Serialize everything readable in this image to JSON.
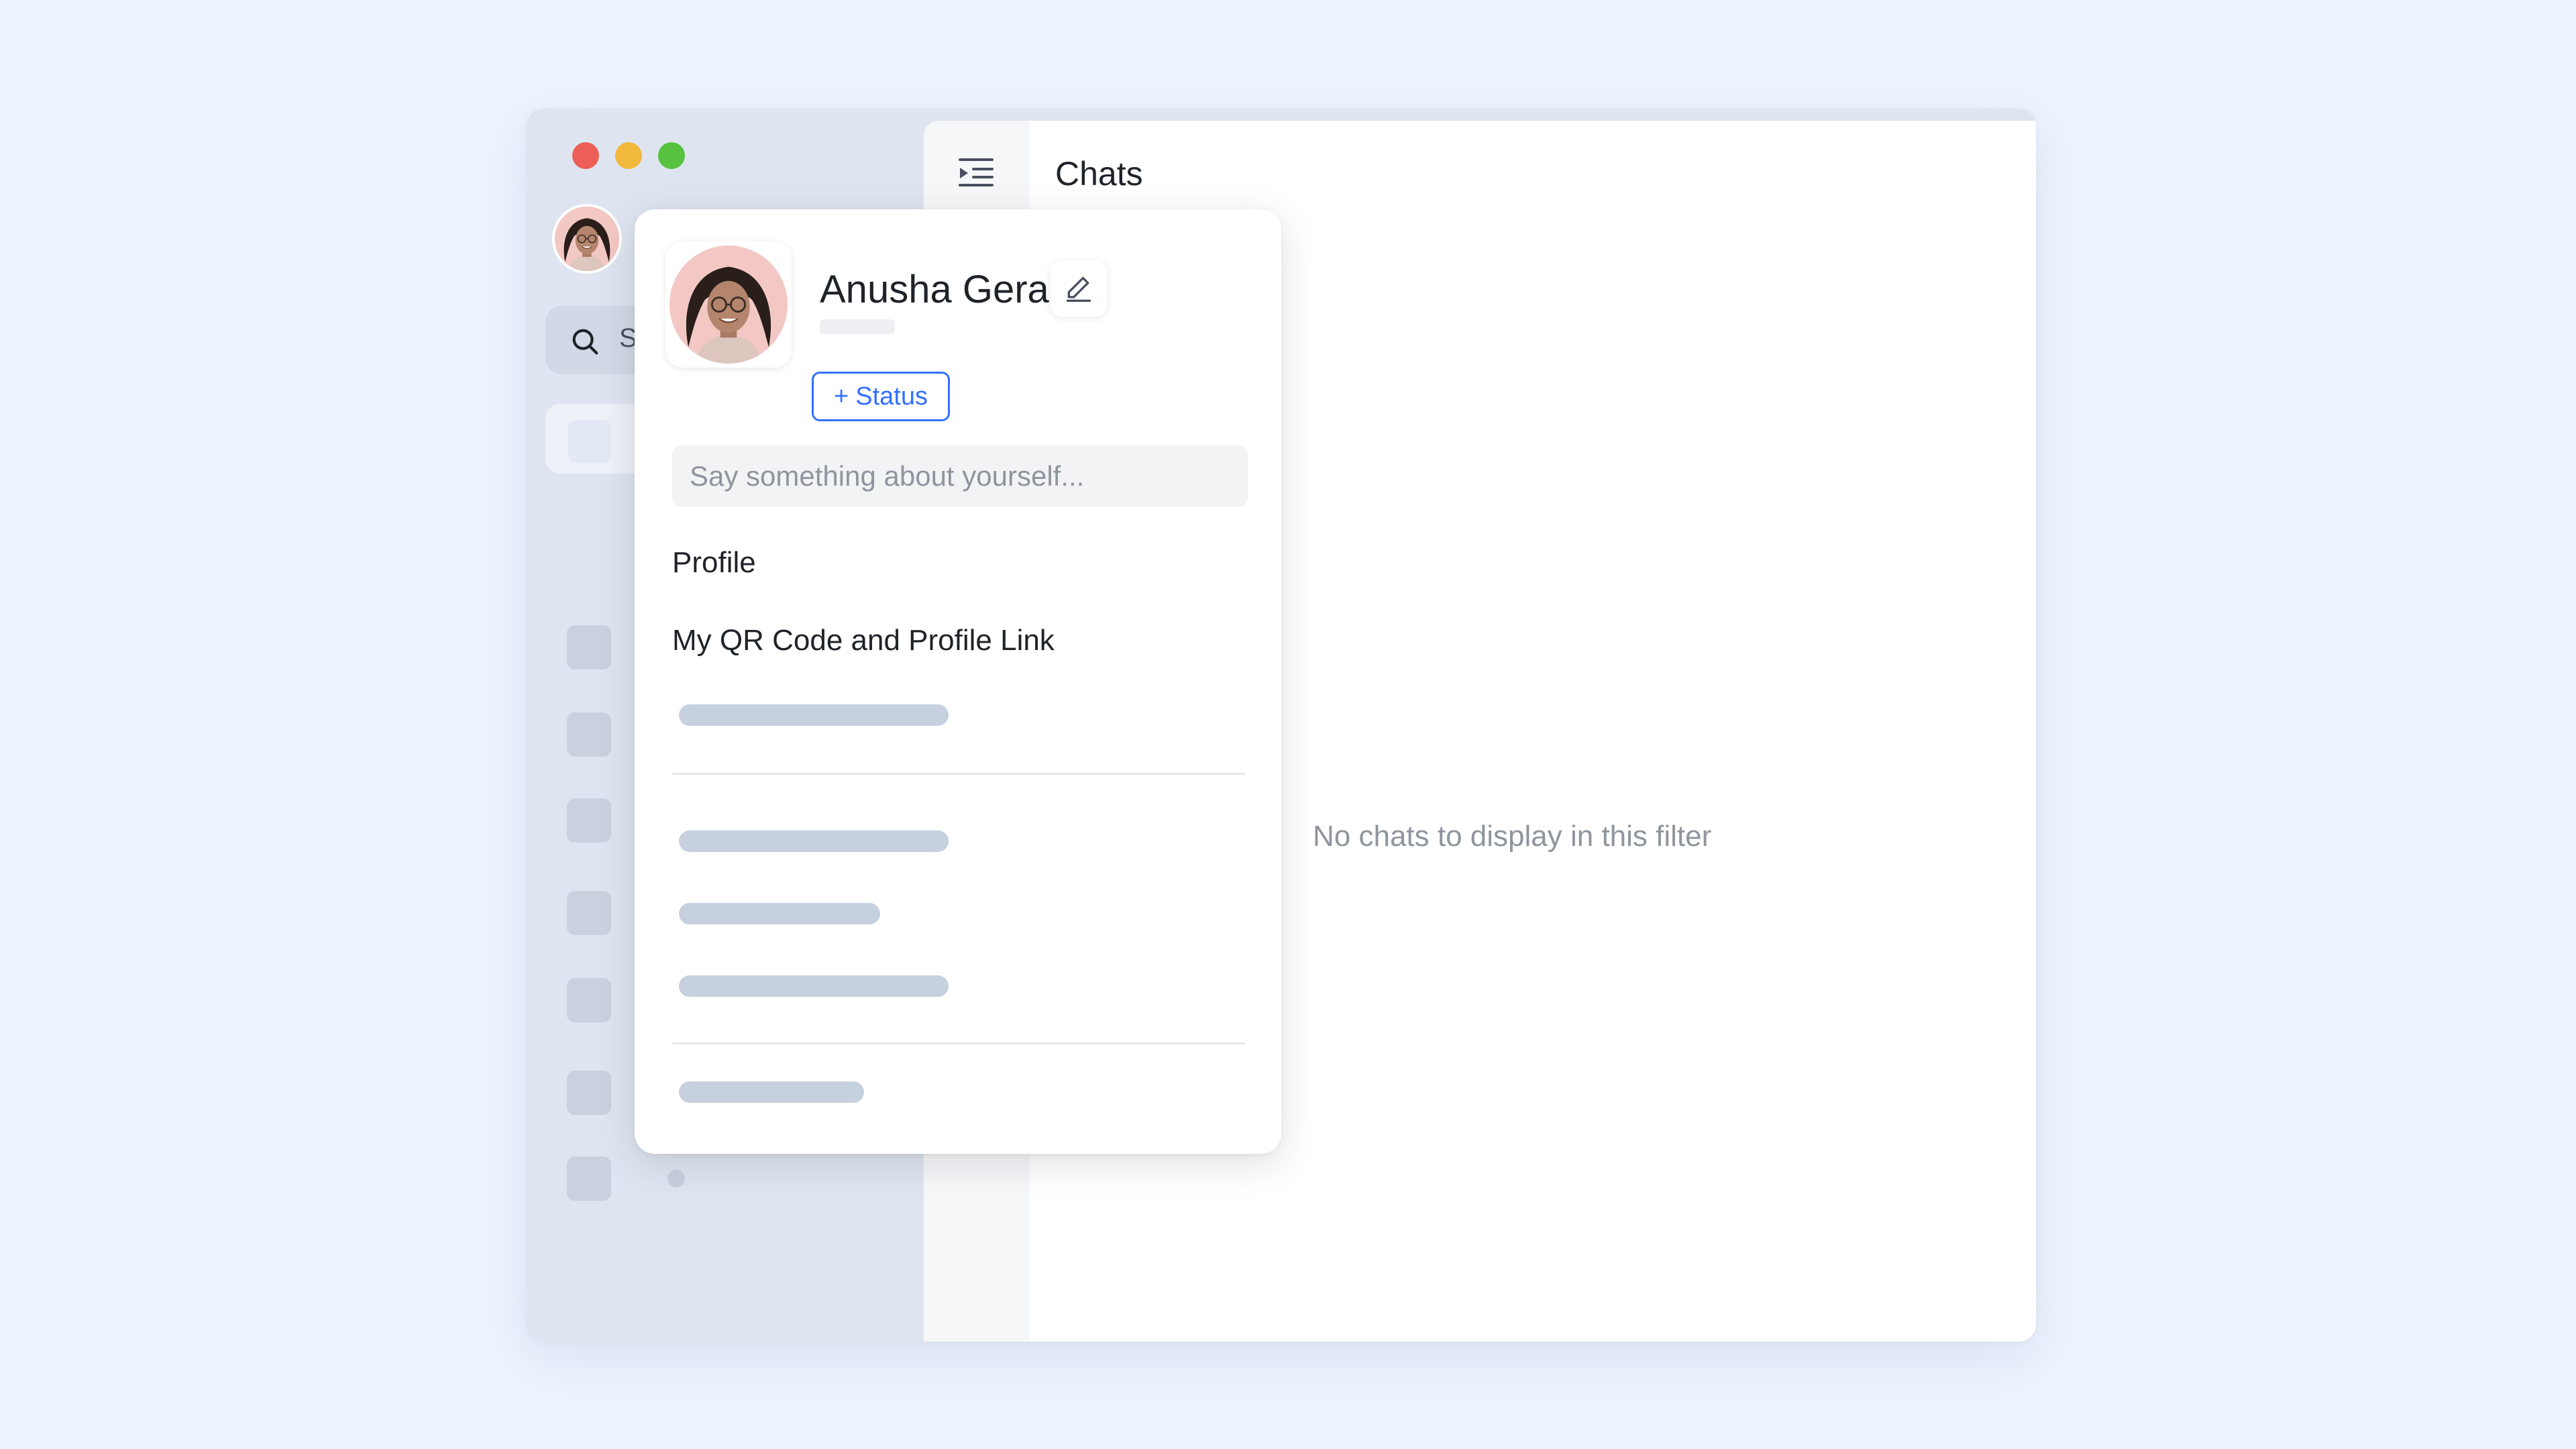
{
  "window": {
    "controls": [
      "close",
      "minimize",
      "zoom"
    ]
  },
  "sidebar": {
    "search_placeholder_visible": "S",
    "item_count": 7
  },
  "main": {
    "title": "Chats",
    "empty_message": "No chats to display in this filter"
  },
  "profile_popover": {
    "user_name": "Anusha Gera",
    "status_button": {
      "icon": "+",
      "label": "Status"
    },
    "about_placeholder": "Say something about yourself...",
    "menu": {
      "profile": "Profile",
      "qr_code": "My QR Code and Profile Link"
    }
  },
  "colors": {
    "background": "#EEF4FE",
    "sidebar": "#DFE5F0",
    "accent": "#3370FF",
    "traffic_close": "#EC5F57",
    "traffic_minimize": "#F2B83C",
    "traffic_zoom": "#56C23F",
    "skeleton": "#C6D0DF"
  }
}
